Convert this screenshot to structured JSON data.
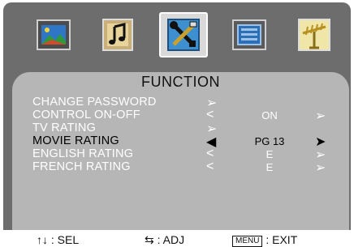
{
  "menu_title": "FUNCTION",
  "tabs": [
    {
      "name": "picture-tab",
      "icon": "picture-icon"
    },
    {
      "name": "sound-tab",
      "icon": "music-note-icon"
    },
    {
      "name": "function-tab",
      "icon": "tools-icon",
      "active": true
    },
    {
      "name": "setup-tab",
      "icon": "display-icon"
    },
    {
      "name": "channel-tab",
      "icon": "antenna-icon"
    }
  ],
  "rows": [
    {
      "label": "CHANGE  PASSWORD",
      "value": ""
    },
    {
      "label": "CONTROL ON-OFF",
      "value": "ON"
    },
    {
      "label": "TV RATING",
      "value": ""
    },
    {
      "label": "MOVIE RATING",
      "value": "PG 13"
    },
    {
      "label": "ENGLISH RATING",
      "value": "E"
    },
    {
      "label": "FRENCH RATING",
      "value": "E"
    }
  ],
  "footer": {
    "sel_label": ": SEL",
    "adj_label": ": ADJ",
    "menu_key": "MENU",
    "exit_label": ": EXIT"
  },
  "colors": {
    "frame": "#6d6d6d",
    "panel": "#b6b6b6",
    "text": "#ffffff",
    "selected_text": "#000000"
  }
}
